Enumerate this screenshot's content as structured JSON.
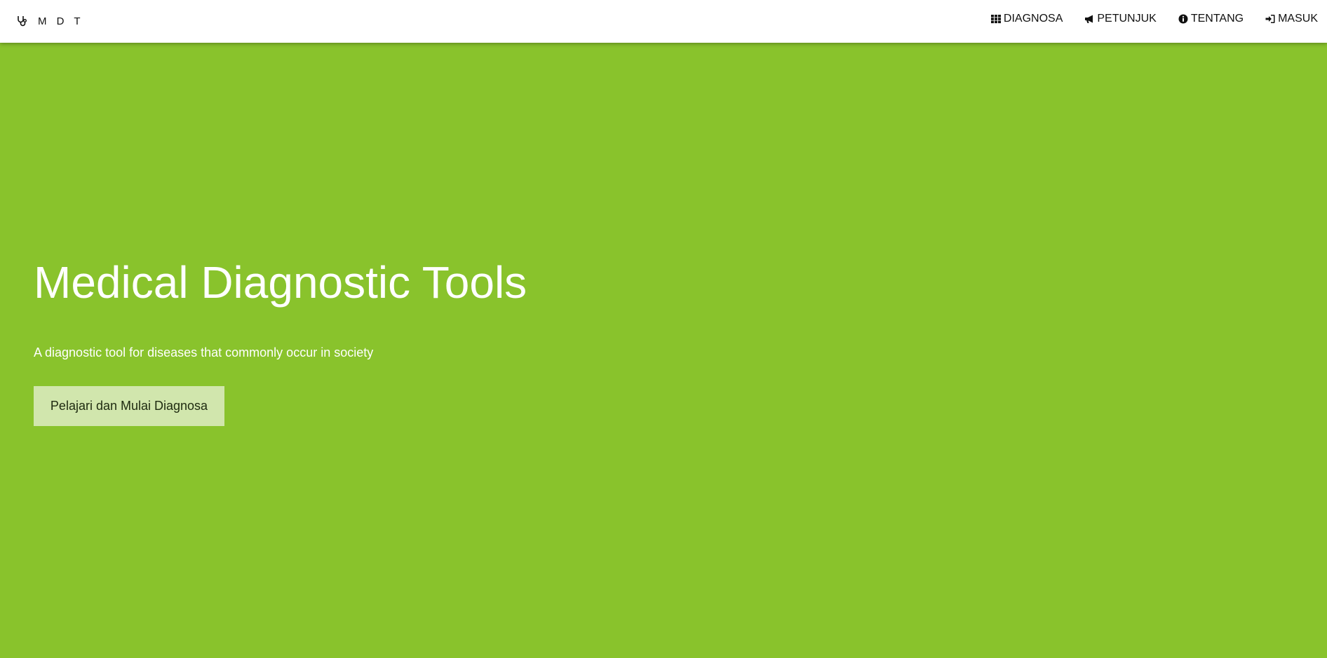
{
  "brand": {
    "icon": "stethoscope-icon",
    "text": "M D T"
  },
  "nav": {
    "items": [
      {
        "icon": "grid-icon",
        "label": "DIAGNOSA"
      },
      {
        "icon": "megaphone-icon",
        "label": "PETUNJUK"
      },
      {
        "icon": "info-circle-icon",
        "label": "TENTANG"
      },
      {
        "icon": "sign-in-icon",
        "label": "MASUK"
      }
    ]
  },
  "hero": {
    "title": "Medical Diagnostic Tools",
    "subtitle": "A diagnostic tool for diseases that commonly occur in society",
    "button_label": "Pelajari dan Mulai Diagnosa"
  },
  "colors": {
    "background": "#89c32c",
    "navbar": "#ffffff",
    "button": "#d1e6ad",
    "text_light": "#ffffff"
  }
}
